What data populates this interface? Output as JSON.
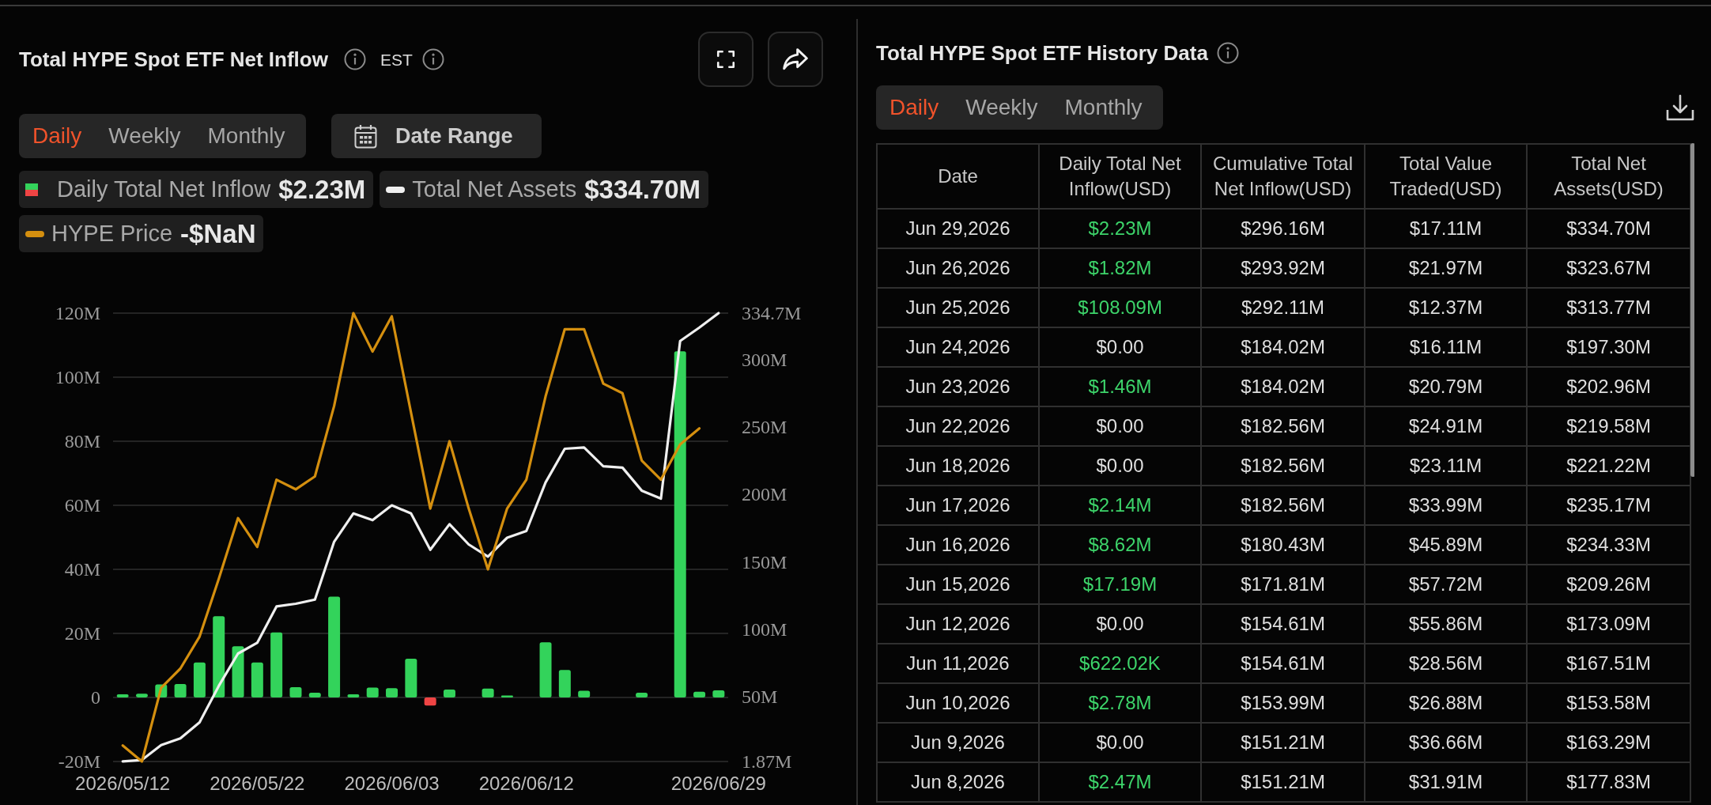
{
  "inflow_panel": {
    "title": "Total HYPE Spot ETF Net Inflow",
    "timezone": "EST",
    "tabs": [
      {
        "label": "Daily",
        "selected": true
      },
      {
        "label": "Weekly",
        "selected": false
      },
      {
        "label": "Monthly",
        "selected": false
      }
    ],
    "date_range": "Date Range",
    "legend_values": [
      "$2.23M",
      "$334.70M",
      "-$NaN"
    ],
    "chart_data": {
      "type": "bar",
      "stacked": true,
      "grid": true,
      "categories": [
        "2026/05/12",
        null,
        null,
        null,
        null,
        null,
        null,
        "2026/05/22",
        null,
        null,
        null,
        null,
        null,
        null,
        "2026/06/03",
        null,
        null,
        null,
        null,
        null,
        null,
        "2026/06/12",
        null,
        null,
        null,
        null,
        null,
        null,
        null,
        null,
        null,
        "2026/06/29"
      ],
      "ylim": [
        -20,
        120
      ],
      "yticks": [
        {
          "value": -20,
          "label": "-20M"
        },
        {
          "value": 0,
          "label": "0"
        },
        {
          "value": 20,
          "label": "20M"
        },
        {
          "value": 40,
          "label": "40M"
        },
        {
          "value": 60,
          "label": "60M"
        },
        {
          "value": 80,
          "label": "80M"
        },
        {
          "value": 100,
          "label": "100M"
        },
        {
          "value": 120,
          "label": "120M"
        }
      ],
      "y2lim": [
        1.87,
        334.7
      ],
      "y2ticks": [
        {
          "value": 1.87,
          "label": "1.87M"
        },
        {
          "value": 50,
          "label": "50M"
        },
        {
          "value": 100,
          "label": "100M"
        },
        {
          "value": 150,
          "label": "150M"
        },
        {
          "value": 200,
          "label": "200M"
        },
        {
          "value": 250,
          "label": "250M"
        },
        {
          "value": 300,
          "label": "300M"
        },
        {
          "value": 334.7,
          "label": "334.7M"
        }
      ],
      "series": [
        {
          "name": "Daily Total Net Inflow",
          "color": "#33d35b",
          "values": [
            1.0,
            1.2,
            4.1,
            4.2,
            10.9,
            25.4,
            16.0,
            10.9,
            20.3,
            3.2,
            1.5,
            31.5,
            1.0,
            3.1,
            2.9,
            12.1,
            null,
            2.5,
            0,
            2.8,
            0.6,
            0,
            17.2,
            8.6,
            2.1,
            0,
            0,
            1.5,
            0,
            108.1,
            1.8,
            2.2
          ]
        },
        {
          "color": "#ef4444",
          "values": [
            null,
            null,
            null,
            null,
            null,
            null,
            null,
            null,
            null,
            null,
            null,
            null,
            null,
            null,
            null,
            null,
            -2.5,
            null,
            null,
            null,
            null,
            null,
            null,
            null,
            null,
            null,
            null,
            null,
            null,
            null,
            null,
            null
          ]
        },
        {
          "name": "Total Net Assets",
          "type": "line",
          "axis": "y2",
          "color": "#efefef",
          "values": [
            2,
            3,
            14,
            19,
            31,
            58,
            82,
            90,
            117,
            119,
            122,
            165,
            186,
            181,
            192,
            186,
            159,
            178,
            163,
            154,
            168,
            173,
            209,
            234,
            235,
            221,
            220,
            203,
            197,
            314,
            324,
            334.7
          ]
        },
        {
          "name": "HYPE Price",
          "type": "line",
          "color": "#d48f0f",
          "values": [
            -15,
            -20,
            3,
            9,
            19,
            37,
            56,
            47,
            68,
            65,
            69,
            91,
            120,
            108,
            119,
            89,
            59,
            80,
            59,
            40,
            59,
            68,
            94,
            115,
            115,
            98,
            95,
            74,
            68,
            79,
            84,
            null
          ]
        }
      ]
    }
  },
  "history_panel": {
    "title": "Total HYPE Spot ETF History Data",
    "tabs": [
      {
        "label": "Daily",
        "selected": true
      },
      {
        "label": "Weekly",
        "selected": false
      },
      {
        "label": "Monthly",
        "selected": false
      }
    ],
    "table": {
      "columns": [
        "Date",
        "Daily Total Net Inflow(USD)",
        "Cumulative Total Net Inflow(USD)",
        "Total Value Traded(USD)",
        "Total Net Assets(USD)"
      ],
      "rows": [
        {
          "cells": [
            "Jun 29,2026",
            "$2.23M",
            "$296.16M",
            "$17.11M",
            "$334.70M"
          ],
          "color": "#3dd46a"
        },
        {
          "cells": [
            "Jun 26,2026",
            "$1.82M",
            "$293.92M",
            "$21.97M",
            "$323.67M"
          ],
          "color": "#3dd46a"
        },
        {
          "cells": [
            "Jun 25,2026",
            "$108.09M",
            "$292.11M",
            "$12.37M",
            "$313.77M"
          ],
          "color": "#3dd46a"
        },
        {
          "cells": [
            "Jun 24,2026",
            "$0.00",
            "$184.02M",
            "$16.11M",
            "$197.30M"
          ],
          "color": "#dedede"
        },
        {
          "cells": [
            "Jun 23,2026",
            "$1.46M",
            "$184.02M",
            "$20.79M",
            "$202.96M"
          ],
          "color": "#3dd46a"
        },
        {
          "cells": [
            "Jun 22,2026",
            "$0.00",
            "$182.56M",
            "$24.91M",
            "$219.58M"
          ],
          "color": "#dedede"
        },
        {
          "cells": [
            "Jun 18,2026",
            "$0.00",
            "$182.56M",
            "$23.11M",
            "$221.22M"
          ],
          "color": "#dedede"
        },
        {
          "cells": [
            "Jun 17,2026",
            "$2.14M",
            "$182.56M",
            "$33.99M",
            "$235.17M"
          ],
          "color": "#3dd46a"
        },
        {
          "cells": [
            "Jun 16,2026",
            "$8.62M",
            "$180.43M",
            "$45.89M",
            "$234.33M"
          ],
          "color": "#3dd46a"
        },
        {
          "cells": [
            "Jun 15,2026",
            "$17.19M",
            "$171.81M",
            "$57.72M",
            "$209.26M"
          ],
          "color": "#3dd46a"
        },
        {
          "cells": [
            "Jun 12,2026",
            "$0.00",
            "$154.61M",
            "$55.86M",
            "$173.09M"
          ],
          "color": "#dedede"
        },
        {
          "cells": [
            "Jun 11,2026",
            "$622.02K",
            "$154.61M",
            "$28.56M",
            "$167.51M"
          ],
          "color": "#3dd46a"
        },
        {
          "cells": [
            "Jun 10,2026",
            "$2.78M",
            "$153.99M",
            "$26.88M",
            "$153.58M"
          ],
          "color": "#3dd46a"
        },
        {
          "cells": [
            "Jun 9,2026",
            "$0.00",
            "$151.21M",
            "$36.66M",
            "$163.29M"
          ],
          "color": "#dedede"
        },
        {
          "cells": [
            "Jun 8,2026",
            "$2.47M",
            "$151.21M",
            "$31.91M",
            "$177.83M"
          ],
          "color": "#3dd46a"
        }
      ]
    }
  }
}
